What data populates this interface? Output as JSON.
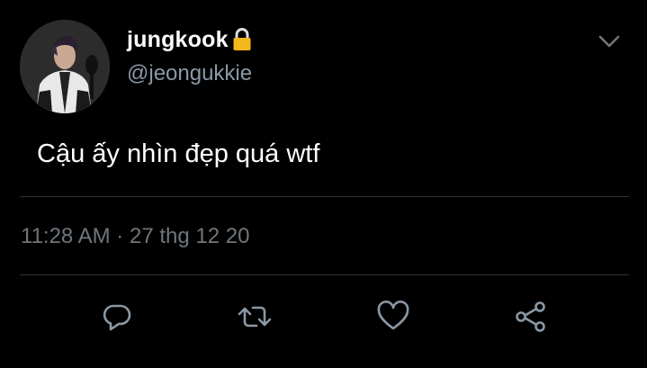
{
  "user": {
    "display_name": "jungkook",
    "handle": "@jeongukkie",
    "protected_icon": "lock-icon"
  },
  "tweet": {
    "text": "Cậu ấy nhìn đẹp quá wtf",
    "time": "11:28 AM",
    "separator": "·",
    "date": "27 thg 12 20"
  },
  "menu": {
    "icon": "chevron-down-icon"
  },
  "actions": [
    {
      "icon": "reply-icon"
    },
    {
      "icon": "retweet-icon"
    },
    {
      "icon": "like-icon"
    },
    {
      "icon": "share-icon"
    }
  ],
  "colors": {
    "background": "#000000",
    "primary_text": "#ffffff",
    "secondary_text": "#8b98a5",
    "meta_text": "#6e767d",
    "icon": "#8b98a5",
    "lock": "#f5b81c",
    "divider": "#2f3336"
  }
}
